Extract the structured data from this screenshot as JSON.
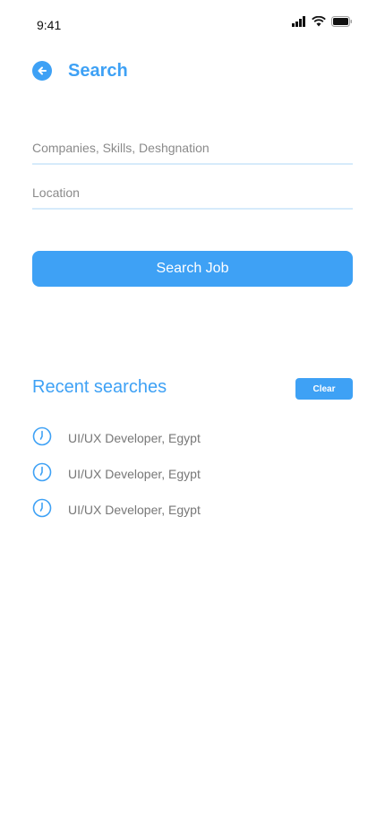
{
  "status_bar": {
    "time": "9:41",
    "icons": [
      "signal-icon",
      "wifi-icon",
      "battery-icon"
    ]
  },
  "header": {
    "title": "Search",
    "back_icon": "arrow-left-circle-icon"
  },
  "search": {
    "keywords_placeholder": "Companies, Skills, Deshgnation",
    "keywords_value": "",
    "location_placeholder": "Location",
    "location_value": "",
    "button_label": "Search Job"
  },
  "recent": {
    "title": "Recent searches",
    "clear_label": "Clear",
    "item_icon": "clock-icon",
    "items": [
      {
        "label": "UI/UX Developer, Egypt"
      },
      {
        "label": "UI/UX Developer, Egypt"
      },
      {
        "label": "UI/UX Developer, Egypt"
      }
    ]
  },
  "colors": {
    "accent": "#3ea1f5",
    "input_underline": "#d6ebfb",
    "muted_text": "#777777"
  }
}
